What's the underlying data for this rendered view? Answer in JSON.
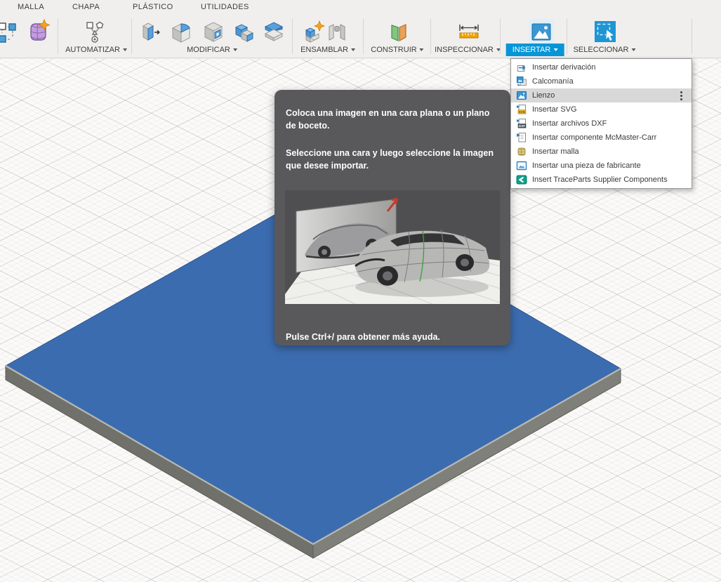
{
  "tabs": {
    "items": [
      {
        "label": "MALLA"
      },
      {
        "label": "CHAPA"
      },
      {
        "label": "PLÁSTICO"
      },
      {
        "label": "UTILIDADES"
      }
    ]
  },
  "toolbar": {
    "groups": [
      {
        "label": "AUTOMATIZAR",
        "icons": [
          "automate-script-icon"
        ]
      },
      {
        "label": "MODIFICAR",
        "icons": [
          "press-pull-icon",
          "fillet-icon",
          "shell-icon",
          "combine-icon",
          "split-body-icon"
        ]
      },
      {
        "label": "ENSAMBLAR",
        "icons": [
          "new-component-icon",
          "joint-icon"
        ]
      },
      {
        "label": "CONSTRUIR",
        "icons": [
          "construction-plane-icon"
        ]
      },
      {
        "label": "INSPECCIONAR",
        "icons": [
          "measure-icon"
        ]
      },
      {
        "label": "INSERTAR",
        "active": true,
        "icons": [
          "canvas-icon"
        ]
      },
      {
        "label": "SELECCIONAR",
        "icons": [
          "select-icon"
        ]
      }
    ],
    "left_icons": [
      "edit-form-icon",
      "create-mesh-icon"
    ]
  },
  "menu": {
    "items": [
      {
        "icon": "insert-derive-icon",
        "label": "Insertar derivación"
      },
      {
        "icon": "decal-icon",
        "label": "Calcomanía"
      },
      {
        "icon": "canvas-icon",
        "label": "Lienzo",
        "selected": true
      },
      {
        "icon": "insert-svg-icon",
        "label": "Insertar SVG",
        "badge": "SVG"
      },
      {
        "icon": "insert-dxf-icon",
        "label": "Insertar archivos DXF",
        "badge": "DXF"
      },
      {
        "icon": "mcmaster-icon",
        "label": "Insertar componente McMaster-Carr"
      },
      {
        "icon": "insert-mesh-icon",
        "label": "Insertar malla"
      },
      {
        "icon": "manufacturer-part-icon",
        "label": "Insertar una pieza de fabricante"
      },
      {
        "icon": "traceparts-icon",
        "label": "Insert TraceParts Supplier Components"
      }
    ]
  },
  "tooltip": {
    "paragraph_1": "Coloca una imagen en una cara plana o un plano de boceto.",
    "paragraph_2": "Seleccione una cara y luego seleccione la imagen que desee importar.",
    "help_text": "Pulse Ctrl+/ para obtener más ayuda."
  },
  "colors": {
    "accent_blue": "#0696d7",
    "toolbar_bg": "#f0efee",
    "menu_highlight": "#d8d8d8",
    "tooltip_bg": "#59595b",
    "plate_top": "#3c6cb0",
    "plate_side_left": "#71716b",
    "plate_side_right": "#80807a",
    "viewport_bg": "#fbfaf9"
  }
}
